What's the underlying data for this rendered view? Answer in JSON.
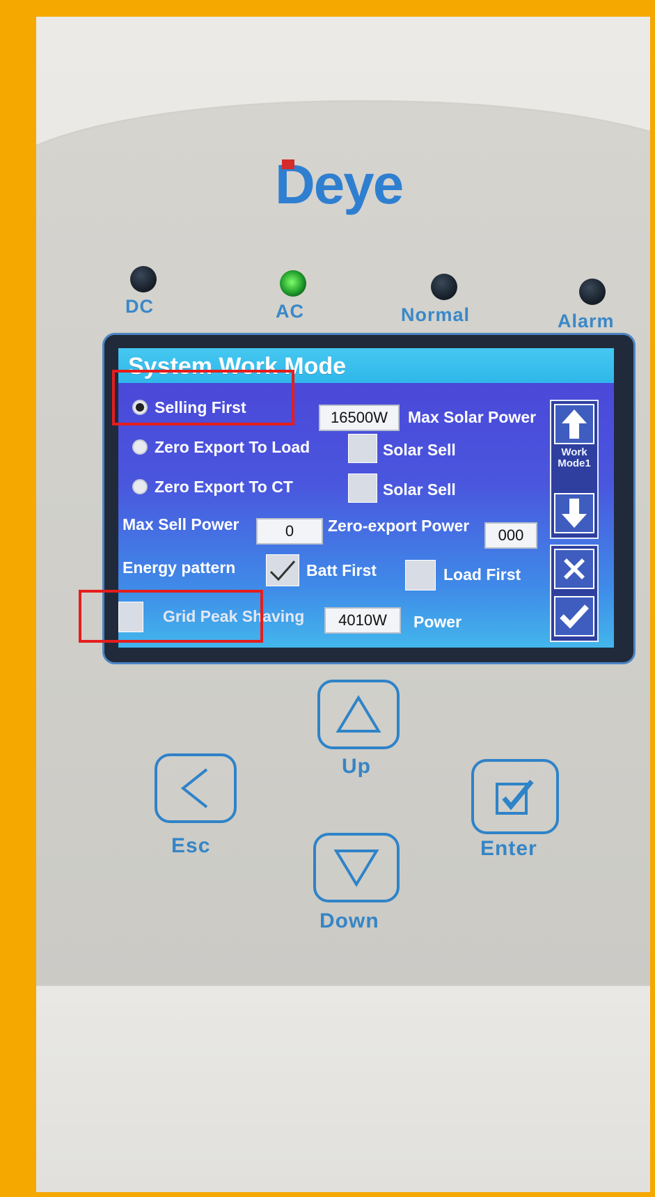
{
  "brand": {
    "name": "Deye",
    "brand_color": "#2f7fd1",
    "mark_color": "#d52b2b"
  },
  "indicators": [
    {
      "label": "DC",
      "state": "off"
    },
    {
      "label": "AC",
      "state": "on"
    },
    {
      "label": "Normal",
      "state": "off"
    },
    {
      "label": "Alarm",
      "state": "off"
    }
  ],
  "screen": {
    "title": "System Work Mode",
    "modes": [
      {
        "label": "Selling First",
        "selected": true
      },
      {
        "label": "Zero Export To Load",
        "selected": false
      },
      {
        "label": "Zero Export To CT",
        "selected": false
      }
    ],
    "max_solar_power": {
      "value": "16500W",
      "label": "Max Solar Power"
    },
    "solar_sell_load": {
      "label": "Solar Sell",
      "checked": false
    },
    "solar_sell_ct": {
      "label": "Solar Sell",
      "checked": false
    },
    "max_sell_power": {
      "label": "Max Sell Power",
      "value": "0"
    },
    "zero_export_power": {
      "label": "Zero-export Power",
      "value": "000"
    },
    "energy_pattern": {
      "label": "Energy pattern",
      "batt_first": {
        "label": "Batt First",
        "checked": true
      },
      "load_first": {
        "label": "Load First",
        "checked": false
      }
    },
    "grid_peak_shaving": {
      "label": "Grid Peak Shaving",
      "checked": false,
      "value": "4010W",
      "unit_label": "Power"
    },
    "side_panel": {
      "page_label": "Work Mode1"
    }
  },
  "keys": [
    {
      "label": "Up",
      "icon": "triangle-up-icon"
    },
    {
      "label": "Esc",
      "icon": "chevron-left-icon"
    },
    {
      "label": "Enter",
      "icon": "check-box-icon"
    },
    {
      "label": "Down",
      "icon": "triangle-down-icon"
    }
  ],
  "highlight_color": "#e51d1d"
}
